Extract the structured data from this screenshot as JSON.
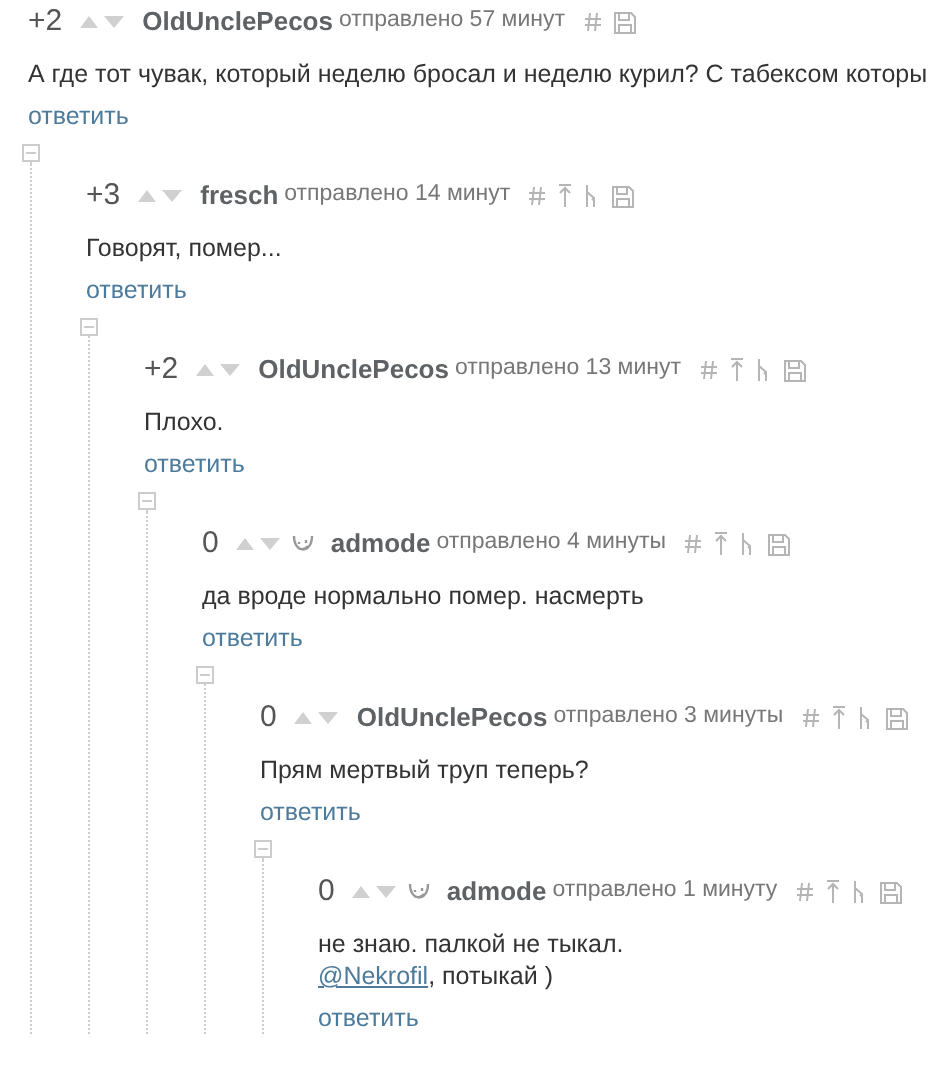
{
  "comments": [
    {
      "rating": "+2",
      "badge": false,
      "author": "OldUnclePecos",
      "sent": "отправлено 57 минут",
      "actions": [
        {
          "kind": "hash"
        },
        {
          "kind": "save"
        }
      ],
      "body": [
        [
          {
            "kind": "text",
            "text": "А где тот чувак, который неделю бросал и неделю курил? С табексом которы"
          }
        ]
      ],
      "reply": "ответить",
      "collapsed": false,
      "children": [
        {
          "rating": "+3",
          "badge": false,
          "author": "fresch",
          "sent": "отправлено 14 минут",
          "actions": [
            {
              "kind": "hash"
            },
            {
              "kind": "parent"
            },
            {
              "kind": "branch"
            },
            {
              "kind": "save"
            }
          ],
          "body": [
            [
              {
                "kind": "text",
                "text": "Говорят, помер..."
              }
            ]
          ],
          "reply": "ответить",
          "collapsed": false,
          "children": [
            {
              "rating": "+2",
              "badge": false,
              "author": "OldUnclePecos",
              "sent": "отправлено 13 минут",
              "actions": [
                {
                  "kind": "hash"
                },
                {
                  "kind": "parent"
                },
                {
                  "kind": "branch"
                },
                {
                  "kind": "save"
                }
              ],
              "body": [
                [
                  {
                    "kind": "text",
                    "text": "Плохо."
                  }
                ]
              ],
              "reply": "ответить",
              "collapsed": false,
              "children": [
                {
                  "rating": "0",
                  "badge": true,
                  "author": "admode",
                  "sent": "отправлено 4 минуты",
                  "actions": [
                    {
                      "kind": "hash"
                    },
                    {
                      "kind": "parent"
                    },
                    {
                      "kind": "branch"
                    },
                    {
                      "kind": "save"
                    }
                  ],
                  "body": [
                    [
                      {
                        "kind": "text",
                        "text": "да вроде нормально помер. насмерть"
                      }
                    ]
                  ],
                  "reply": "ответить",
                  "collapsed": false,
                  "children": [
                    {
                      "rating": "0",
                      "badge": false,
                      "author": "OldUnclePecos",
                      "sent": "отправлено 3 минуты",
                      "actions": [
                        {
                          "kind": "hash"
                        },
                        {
                          "kind": "parent"
                        },
                        {
                          "kind": "branch"
                        },
                        {
                          "kind": "save"
                        }
                      ],
                      "body": [
                        [
                          {
                            "kind": "text",
                            "text": "Прям мертвый труп теперь?"
                          }
                        ]
                      ],
                      "reply": "ответить",
                      "collapsed": false,
                      "children": [
                        {
                          "rating": "0",
                          "badge": true,
                          "author": "admode",
                          "sent": "отправлено 1 минуту",
                          "actions": [
                            {
                              "kind": "hash"
                            },
                            {
                              "kind": "parent"
                            },
                            {
                              "kind": "branch"
                            },
                            {
                              "kind": "save"
                            }
                          ],
                          "body": [
                            [
                              {
                                "kind": "text",
                                "text": "не знаю. палкой не тыкал."
                              }
                            ],
                            [
                              {
                                "kind": "mention",
                                "text": "@Nekrofil"
                              },
                              {
                                "kind": "text",
                                "text": ", потыкай )"
                              }
                            ]
                          ],
                          "reply": "ответить"
                        }
                      ]
                    }
                  ]
                }
              ]
            }
          ]
        }
      ]
    }
  ]
}
